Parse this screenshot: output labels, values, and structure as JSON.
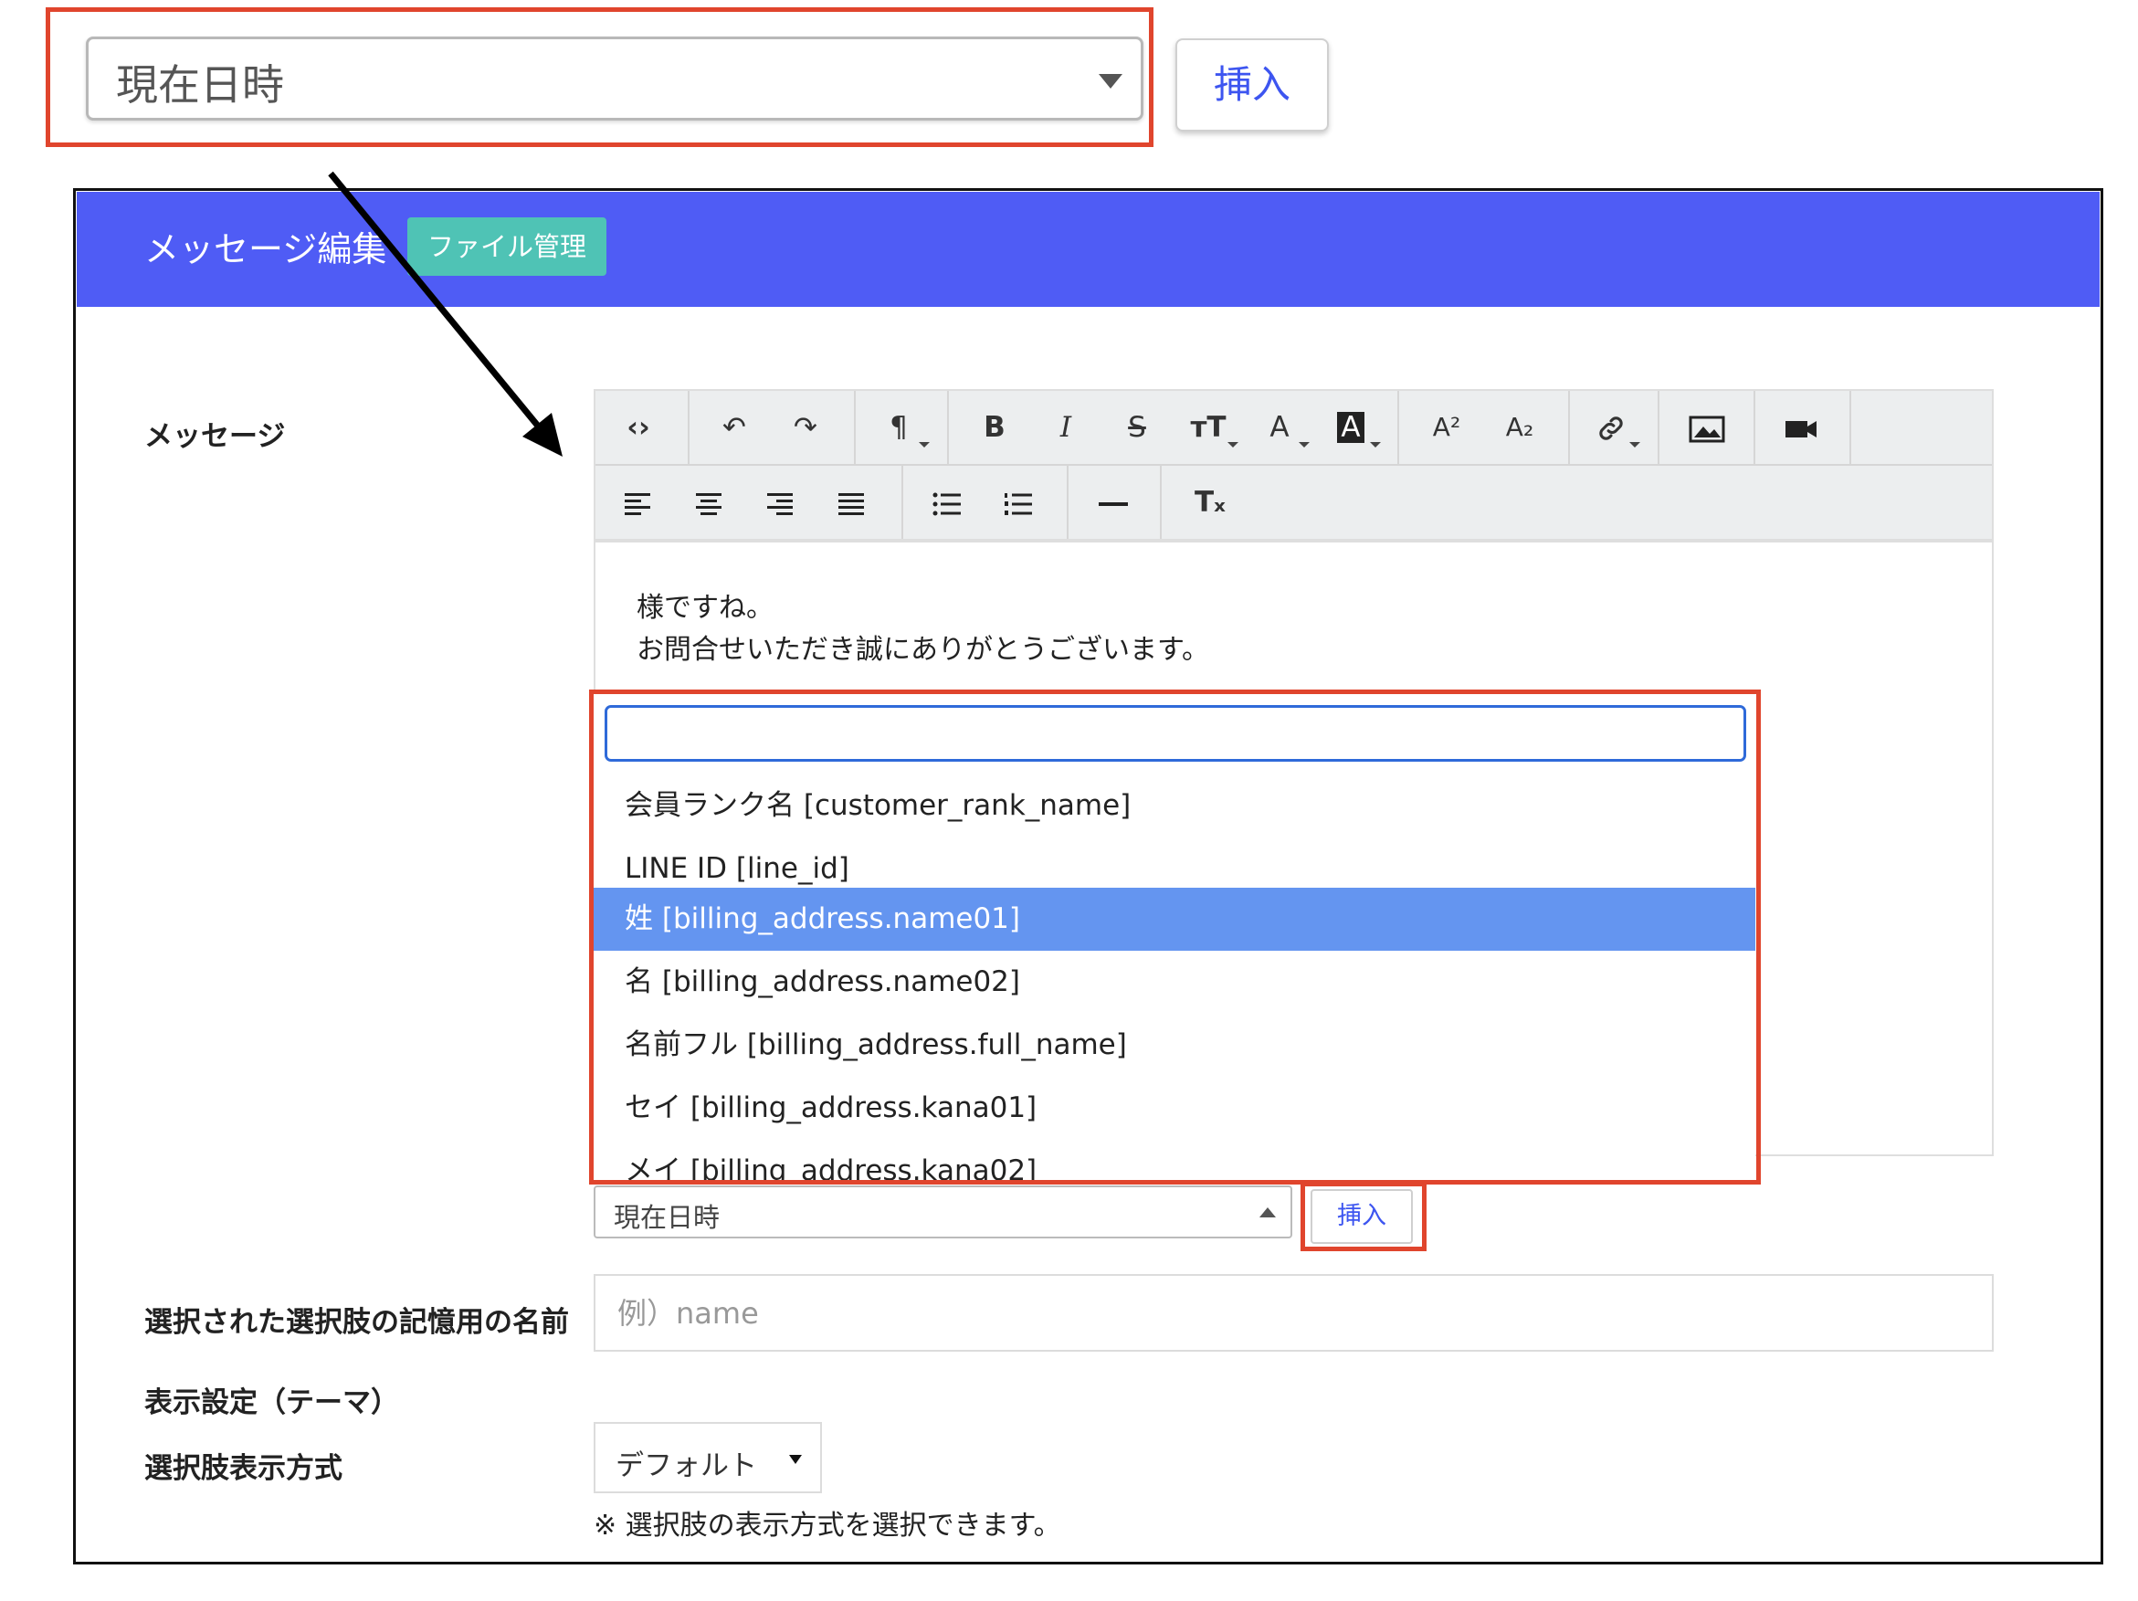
{
  "callout": {
    "select_value": "現在日時",
    "insert_label": "挿入"
  },
  "header": {
    "title": "メッセージ編集",
    "file_button": "ファイル管理"
  },
  "form": {
    "message_label": "メッセージ",
    "name_label": "選択された選択肢の記憶用の名前",
    "name_placeholder": "例）name",
    "theme_label": "表示設定（テーマ）",
    "mode_label": "選択肢表示方式",
    "mode_value": "デフォルト",
    "mode_note": "※ 選択肢の表示方式を選択できます。"
  },
  "toolbar": {
    "row1": [
      {
        "name": "code-view-icon",
        "glyph": "‹›"
      },
      {
        "name": "undo-icon",
        "glyph": "↶"
      },
      {
        "name": "redo-icon",
        "glyph": "↷"
      },
      {
        "name": "paragraph-icon",
        "glyph": "¶"
      },
      {
        "name": "bold-icon",
        "glyph": "B"
      },
      {
        "name": "italic-icon",
        "glyph": "I"
      },
      {
        "name": "strikethrough-icon",
        "glyph": "S"
      },
      {
        "name": "font-size-icon",
        "glyph": "тT"
      },
      {
        "name": "font-color-icon",
        "glyph": "A"
      },
      {
        "name": "background-color-icon",
        "glyph": "A"
      },
      {
        "name": "superscript-icon",
        "glyph": "A²"
      },
      {
        "name": "subscript-icon",
        "glyph": "A₂"
      },
      {
        "name": "link-icon",
        "glyph": "🔗"
      },
      {
        "name": "image-icon",
        "glyph": "▣"
      },
      {
        "name": "video-icon",
        "glyph": "■"
      }
    ],
    "row2": [
      {
        "name": "align-left-icon",
        "glyph": "≡"
      },
      {
        "name": "align-center-icon",
        "glyph": "≡"
      },
      {
        "name": "align-right-icon",
        "glyph": "≡"
      },
      {
        "name": "align-justify-icon",
        "glyph": "≡"
      },
      {
        "name": "bullet-list-icon",
        "glyph": "☰"
      },
      {
        "name": "numbered-list-icon",
        "glyph": "☰"
      },
      {
        "name": "horizontal-rule-icon",
        "glyph": "—"
      },
      {
        "name": "clear-format-icon",
        "glyph": "Tₓ"
      }
    ]
  },
  "editor": {
    "lines": [
      "様ですね。",
      "お問合せいただき誠にありがとうございます。"
    ]
  },
  "dropdown": {
    "search_value": "",
    "items": [
      "会員ランク名 [customer_rank_name]",
      "LINE ID [line_id]",
      "姓 [billing_address.name01]",
      "名 [billing_address.name02]",
      "名前フル [billing_address.full_name]",
      "セイ [billing_address.kana01]",
      "メイ [billing_address.kana02]"
    ],
    "selected_index": 2
  },
  "bottom": {
    "select_value": "現在日時",
    "insert_label": "挿入"
  },
  "colors": {
    "header_bg": "#4f5cf5",
    "file_button_bg": "#4fc3b5",
    "highlight_red": "#e0452d",
    "selected_item_bg": "#6495f0",
    "insert_text": "#3d55f0"
  }
}
